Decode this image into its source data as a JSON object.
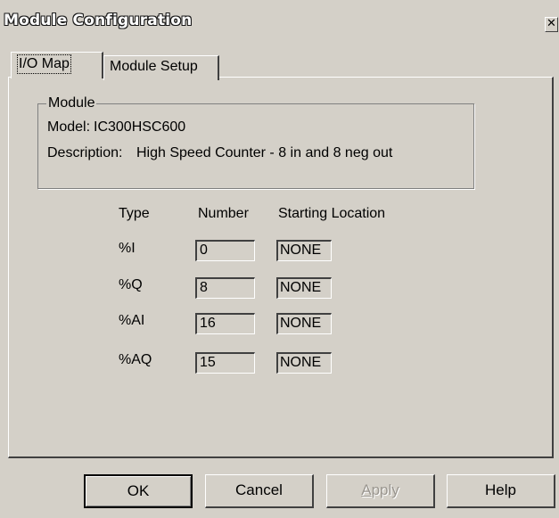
{
  "window": {
    "title": "Module Configuration",
    "close_glyph": "✕"
  },
  "tabs": [
    {
      "label": "I/O Map",
      "selected": true
    },
    {
      "label": "Module Setup",
      "selected": false
    }
  ],
  "module_group": {
    "legend": "Module",
    "model_label": "Model:",
    "model_value": "IC300HSC600",
    "description_label": "Description:",
    "description_value": "High Speed Counter - 8 in and 8 neg out"
  },
  "io_table": {
    "headers": {
      "type": "Type",
      "number": "Number",
      "starting_location": "Starting Location"
    },
    "rows": [
      {
        "type": "%I",
        "number": "0",
        "starting_location": "NONE"
      },
      {
        "type": "%Q",
        "number": "8",
        "starting_location": "NONE"
      },
      {
        "type": "%AI",
        "number": "16",
        "starting_location": "NONE"
      },
      {
        "type": "%AQ",
        "number": "15",
        "starting_location": "NONE"
      }
    ]
  },
  "buttons": {
    "ok": "OK",
    "cancel": "Cancel",
    "apply_first": "A",
    "apply_rest": "pply",
    "help": "Help"
  },
  "colors": {
    "face": "#d4d0c8",
    "highlight": "#ffffff",
    "shadow": "#404040",
    "disabled_text": "#9a968f"
  }
}
